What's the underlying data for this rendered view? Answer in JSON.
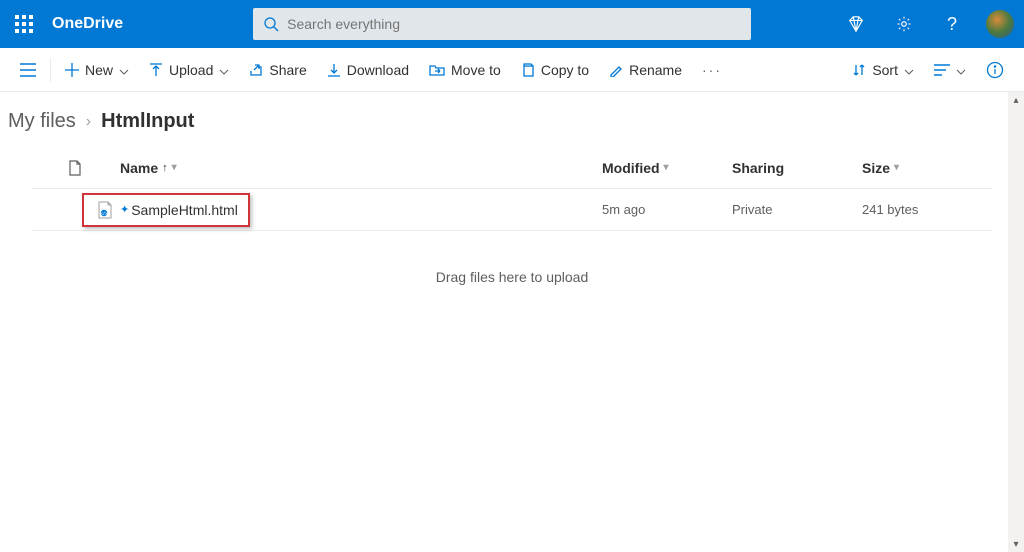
{
  "header": {
    "app_name": "OneDrive",
    "search_placeholder": "Search everything"
  },
  "commands": {
    "new": "New",
    "upload": "Upload",
    "share": "Share",
    "download": "Download",
    "move_to": "Move to",
    "copy_to": "Copy to",
    "rename": "Rename",
    "sort": "Sort"
  },
  "breadcrumb": {
    "root": "My files",
    "current": "HtmlInput"
  },
  "columns": {
    "name": "Name",
    "modified": "Modified",
    "sharing": "Sharing",
    "size": "Size"
  },
  "files": [
    {
      "name": "SampleHtml.html",
      "modified": "5m ago",
      "sharing": "Private",
      "size": "241 bytes"
    }
  ],
  "drag_hint": "Drag files here to upload"
}
